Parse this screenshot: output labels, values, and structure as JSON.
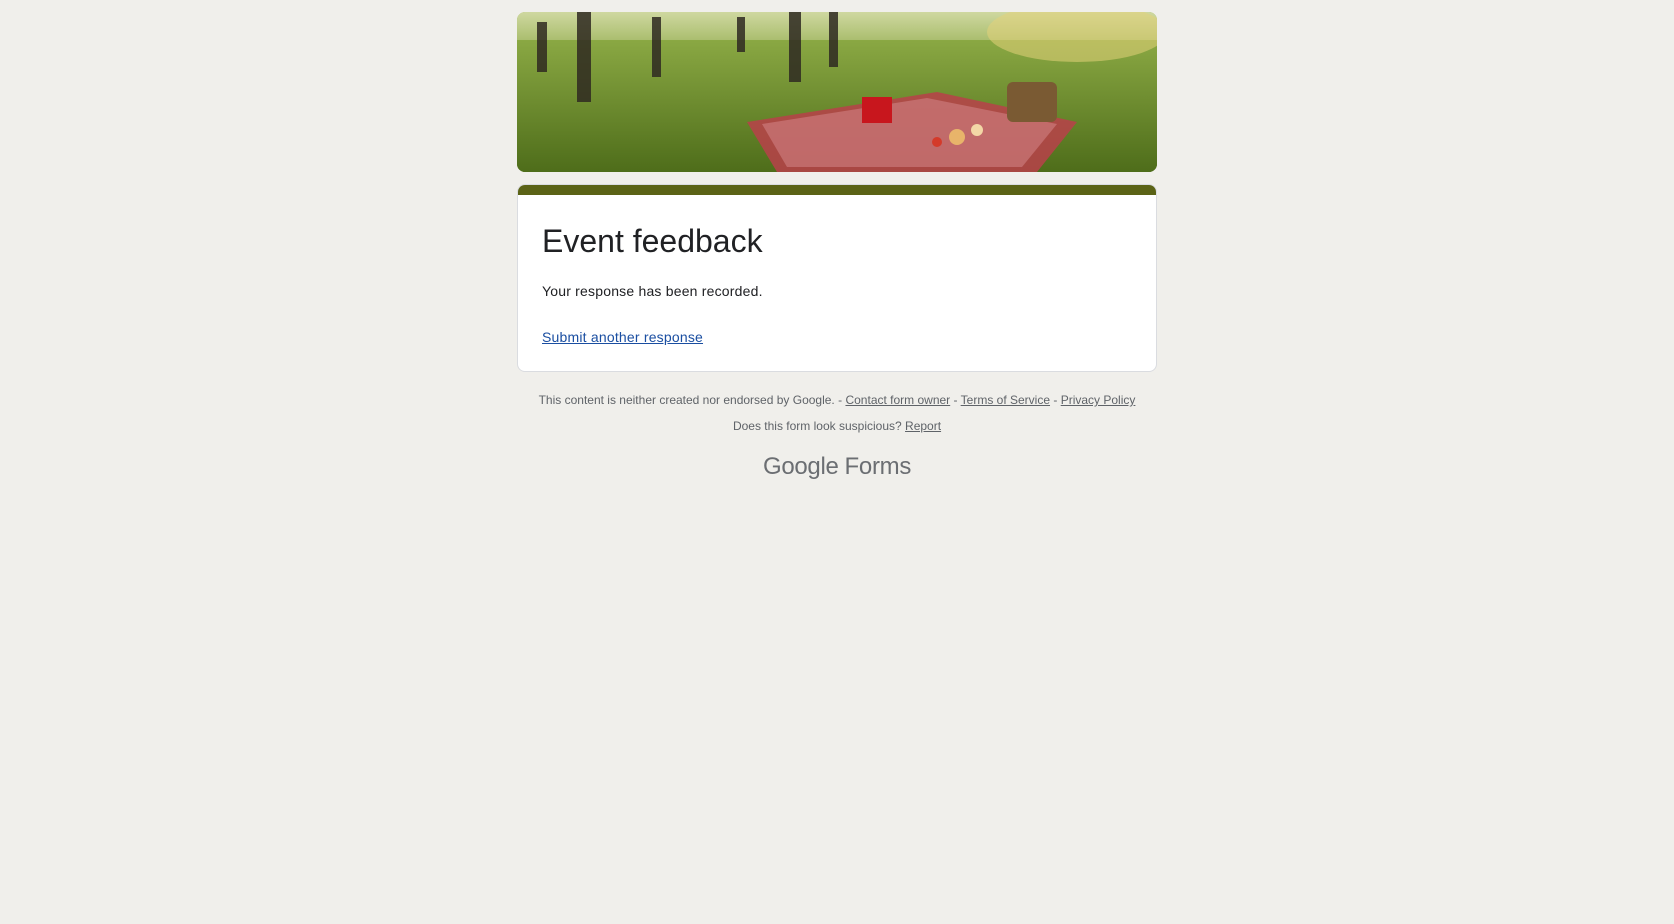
{
  "form": {
    "title": "Event feedback",
    "confirmation_message": "Your response has been recorded.",
    "submit_another_label": "Submit another response",
    "accent_color": "#5b6316"
  },
  "footer": {
    "disclaimer": "This content is neither created nor endorsed by Google.",
    "separator": "-",
    "contact_owner_label": "Contact form owner",
    "terms_label": "Terms of Service",
    "privacy_label": "Privacy Policy",
    "suspicious_text": "Does this form look suspicious?",
    "report_label": "Report"
  },
  "brand": {
    "google": "Google",
    "forms": "Forms"
  },
  "banner": {
    "icon": "picnic-header-image"
  }
}
